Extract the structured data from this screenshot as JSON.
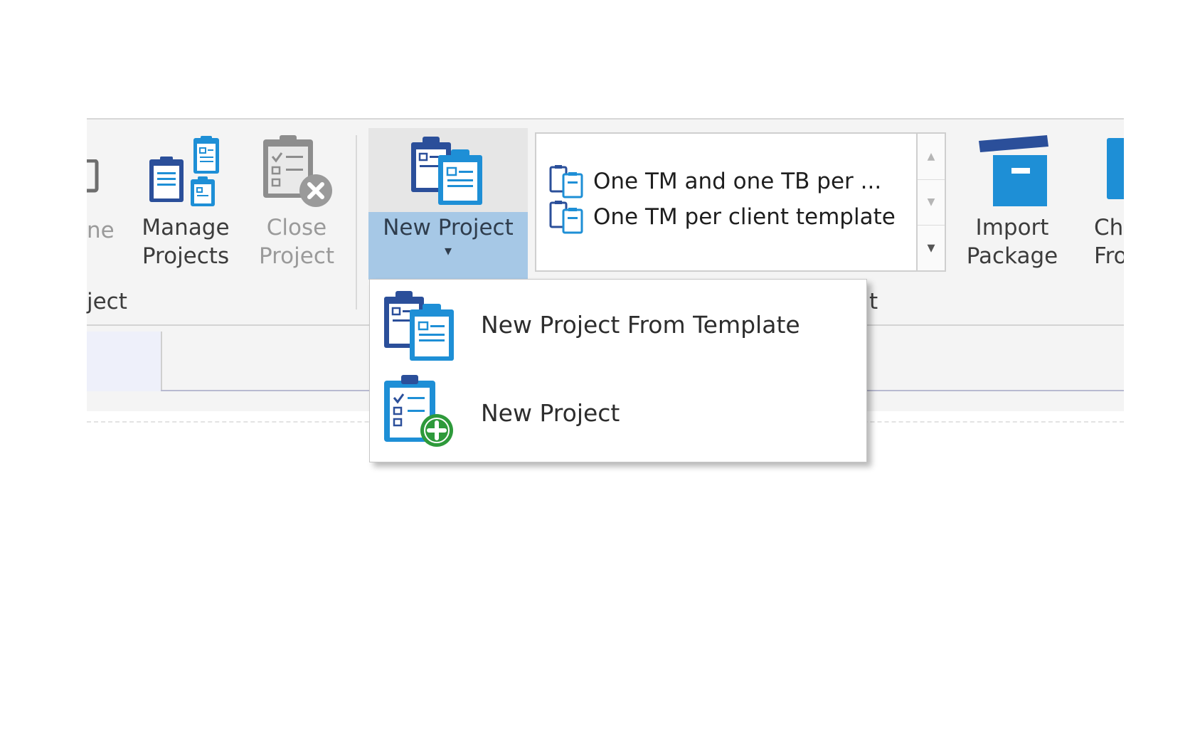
{
  "ribbon": {
    "partial_button_label": "ne",
    "manage_projects": {
      "line1": "Manage",
      "line2": "Projects"
    },
    "close_project": {
      "line1": "Close",
      "line2": "Project"
    },
    "group_label_partial": "ject",
    "new_project_split": {
      "label": "New Project",
      "arrow": "▾"
    },
    "gallery": {
      "items": [
        {
          "label": "One TM and one TB per ..."
        },
        {
          "label": "One TM per client template"
        }
      ],
      "scroll_up": "▲",
      "scroll_down": "▼",
      "more": "▾"
    },
    "group_label_partial_2": "t",
    "import_package": {
      "line1": "Import",
      "line2": "Package"
    },
    "cut_button": {
      "line1": "Ch",
      "line2": "Fro"
    }
  },
  "dropdown": {
    "items": [
      {
        "label": "New Project From Template",
        "icon": "project-template-icon"
      },
      {
        "label": "New Project",
        "icon": "new-project-add-icon"
      }
    ]
  },
  "colors": {
    "icon_dark_blue": "#2b4f9a",
    "icon_light_blue": "#1e8fd6",
    "split_highlight": "#a6c8e6",
    "add_green": "#2e9a3b"
  }
}
